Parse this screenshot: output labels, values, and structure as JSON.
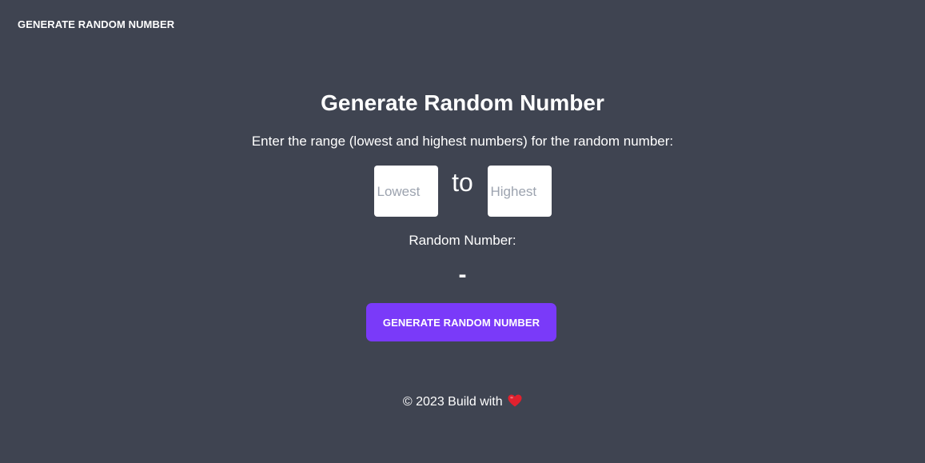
{
  "nav": {
    "brand": "GENERATE RANDOM NUMBER"
  },
  "main": {
    "title": "Generate Random Number",
    "instructions": "Enter the range (lowest and highest numbers) for the random number:",
    "lowest": {
      "placeholder": "Lowest",
      "value": ""
    },
    "separator": "to",
    "highest": {
      "placeholder": "Highest",
      "value": ""
    },
    "result_label": "Random Number:",
    "result_value": "-",
    "generate_label": "GENERATE RANDOM NUMBER"
  },
  "footer": {
    "text": "© 2023 Build with",
    "icon": "heart-icon"
  },
  "colors": {
    "background": "#3f4451",
    "text": "#ffffff",
    "accent": "#7a3af9",
    "heart": "#e0212e"
  }
}
